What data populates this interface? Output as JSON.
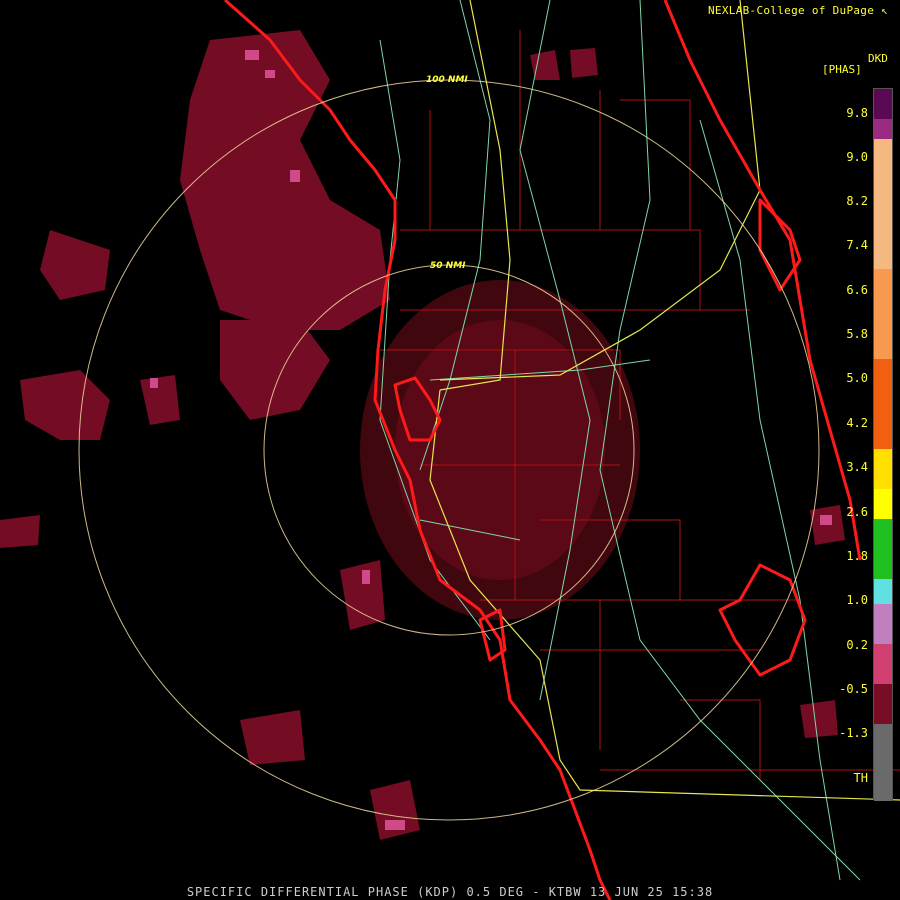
{
  "header": {
    "credit": "NEXLAB-College of DuPage ↖"
  },
  "legend": {
    "unit": "[PHAS]",
    "code": "DKD",
    "ticks": [
      "9.8",
      "9.0",
      "8.2",
      "7.4",
      "6.6",
      "5.8",
      "5.0",
      "4.2",
      "3.4",
      "2.6",
      "1.8",
      "1.0",
      "0.2",
      "-0.5",
      "-1.3",
      "TH"
    ]
  },
  "range_rings": {
    "inner_label": "50 NMI",
    "outer_label": "100 NMI"
  },
  "footer": {
    "caption": "SPECIFIC DIFFERENTIAL PHASE (KDP) 0.5 DEG - KTBW 13 JUN 25 15:38"
  },
  "colors": {
    "coast": "#ff1a1a",
    "counties": "#b01010",
    "highways": "#7fd7a8",
    "interstates": "#e6e64d",
    "rings": "#f2d9a0",
    "echo": "#8a0f2a",
    "text": "#ffff33"
  }
}
